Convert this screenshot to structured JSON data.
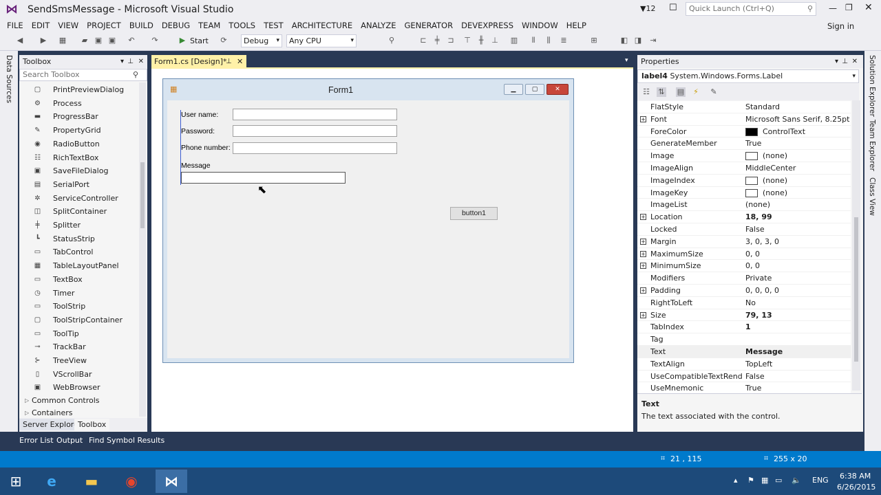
{
  "window": {
    "title": "SendSmsMessage - Microsoft Visual Studio",
    "notif_count": "12",
    "quick_launch_placeholder": "Quick Launch (Ctrl+Q)",
    "sign_in": "Sign in"
  },
  "menu": [
    "FILE",
    "EDIT",
    "VIEW",
    "PROJECT",
    "BUILD",
    "DEBUG",
    "TEAM",
    "TOOLS",
    "TEST",
    "ARCHITECTURE",
    "ANALYZE",
    "GENERATOR",
    "DEVEXPRESS",
    "WINDOW",
    "HELP"
  ],
  "toolbar": {
    "start_label": "Start",
    "config": "Debug",
    "platform": "Any CPU"
  },
  "left_strip": {
    "data_sources": "Data Sources"
  },
  "toolbox": {
    "title": "Toolbox",
    "search_placeholder": "Search Toolbox",
    "items": [
      {
        "label": "PrintPreviewDialog",
        "icon": "print-preview-icon",
        "glyph": "▢"
      },
      {
        "label": "Process",
        "icon": "process-icon",
        "glyph": "⚙"
      },
      {
        "label": "ProgressBar",
        "icon": "progressbar-icon",
        "glyph": "▬"
      },
      {
        "label": "PropertyGrid",
        "icon": "propertygrid-icon",
        "glyph": "✎"
      },
      {
        "label": "RadioButton",
        "icon": "radiobutton-icon",
        "glyph": "◉"
      },
      {
        "label": "RichTextBox",
        "icon": "richtextbox-icon",
        "glyph": "☷"
      },
      {
        "label": "SaveFileDialog",
        "icon": "savefiledialog-icon",
        "glyph": "▣"
      },
      {
        "label": "SerialPort",
        "icon": "serialport-icon",
        "glyph": "▤"
      },
      {
        "label": "ServiceController",
        "icon": "servicecontroller-icon",
        "glyph": "✲"
      },
      {
        "label": "SplitContainer",
        "icon": "splitcontainer-icon",
        "glyph": "◫"
      },
      {
        "label": "Splitter",
        "icon": "splitter-icon",
        "glyph": "╪"
      },
      {
        "label": "StatusStrip",
        "icon": "statusstrip-icon",
        "glyph": "┗"
      },
      {
        "label": "TabControl",
        "icon": "tabcontrol-icon",
        "glyph": "▭"
      },
      {
        "label": "TableLayoutPanel",
        "icon": "tablelayoutpanel-icon",
        "glyph": "▦"
      },
      {
        "label": "TextBox",
        "icon": "textbox-icon",
        "glyph": "▭"
      },
      {
        "label": "Timer",
        "icon": "timer-icon",
        "glyph": "◷"
      },
      {
        "label": "ToolStrip",
        "icon": "toolstrip-icon",
        "glyph": "▭"
      },
      {
        "label": "ToolStripContainer",
        "icon": "toolstripcontainer-icon",
        "glyph": "▢"
      },
      {
        "label": "ToolTip",
        "icon": "tooltip-icon",
        "glyph": "▭"
      },
      {
        "label": "TrackBar",
        "icon": "trackbar-icon",
        "glyph": "⊸"
      },
      {
        "label": "TreeView",
        "icon": "treeview-icon",
        "glyph": "⊱"
      },
      {
        "label": "VScrollBar",
        "icon": "vscrollbar-icon",
        "glyph": "▯"
      },
      {
        "label": "WebBrowser",
        "icon": "webbrowser-icon",
        "glyph": "▣"
      }
    ],
    "categories": [
      "Common Controls",
      "Containers"
    ],
    "tabs": [
      "Server Explorer",
      "Toolbox"
    ]
  },
  "bottom_tabs": [
    "Error List",
    "Output",
    "Find Symbol Results"
  ],
  "editor": {
    "tab_label": "Form1.cs [Design]*"
  },
  "form": {
    "title": "Form1",
    "label_username": "User name:",
    "label_password": "Password:",
    "label_phone": "Phone number:",
    "label_message": "Message",
    "button1": "button1"
  },
  "properties": {
    "title": "Properties",
    "selected_object": "label4",
    "selected_type": "System.Windows.Forms.Label",
    "rows": [
      {
        "name": "FlatStyle",
        "value": "Standard"
      },
      {
        "name": "Font",
        "value": "Microsoft Sans Serif, 8.25pt",
        "expand": true
      },
      {
        "name": "ForeColor",
        "value": "ControlText",
        "swatch": "black"
      },
      {
        "name": "GenerateMember",
        "value": "True"
      },
      {
        "name": "Image",
        "value": "(none)",
        "swatch": "white"
      },
      {
        "name": "ImageAlign",
        "value": "MiddleCenter"
      },
      {
        "name": "ImageIndex",
        "value": "(none)",
        "swatch": "white"
      },
      {
        "name": "ImageKey",
        "value": "(none)",
        "swatch": "white"
      },
      {
        "name": "ImageList",
        "value": "(none)"
      },
      {
        "name": "Location",
        "value": "18, 99",
        "expand": true,
        "bold": true
      },
      {
        "name": "Locked",
        "value": "False"
      },
      {
        "name": "Margin",
        "value": "3, 0, 3, 0",
        "expand": true
      },
      {
        "name": "MaximumSize",
        "value": "0, 0",
        "expand": true
      },
      {
        "name": "MinimumSize",
        "value": "0, 0",
        "expand": true
      },
      {
        "name": "Modifiers",
        "value": "Private"
      },
      {
        "name": "Padding",
        "value": "0, 0, 0, 0",
        "expand": true
      },
      {
        "name": "RightToLeft",
        "value": "No"
      },
      {
        "name": "Size",
        "value": "79, 13",
        "expand": true,
        "bold": true
      },
      {
        "name": "TabIndex",
        "value": "1",
        "bold": true
      },
      {
        "name": "Tag",
        "value": ""
      },
      {
        "name": "Text",
        "value": "Message",
        "bold": true,
        "selected": true
      },
      {
        "name": "TextAlign",
        "value": "TopLeft"
      },
      {
        "name": "UseCompatibleTextRenderi",
        "value": "False"
      },
      {
        "name": "UseMnemonic",
        "value": "True"
      }
    ],
    "desc_title": "Text",
    "desc_body": "The text associated with the control."
  },
  "right_strip": [
    "Solution Explorer",
    "Team Explorer",
    "Class View"
  ],
  "statusbar": {
    "position": "21 , 115",
    "size": "255 x 20"
  },
  "taskbar": {
    "lang": "ENG",
    "time": "6:38 AM",
    "date": "6/26/2015"
  },
  "colors": {
    "accent": "#007acc",
    "tab_active": "#fff1a8",
    "chrome": "#eeeef2",
    "dark": "#293955"
  }
}
